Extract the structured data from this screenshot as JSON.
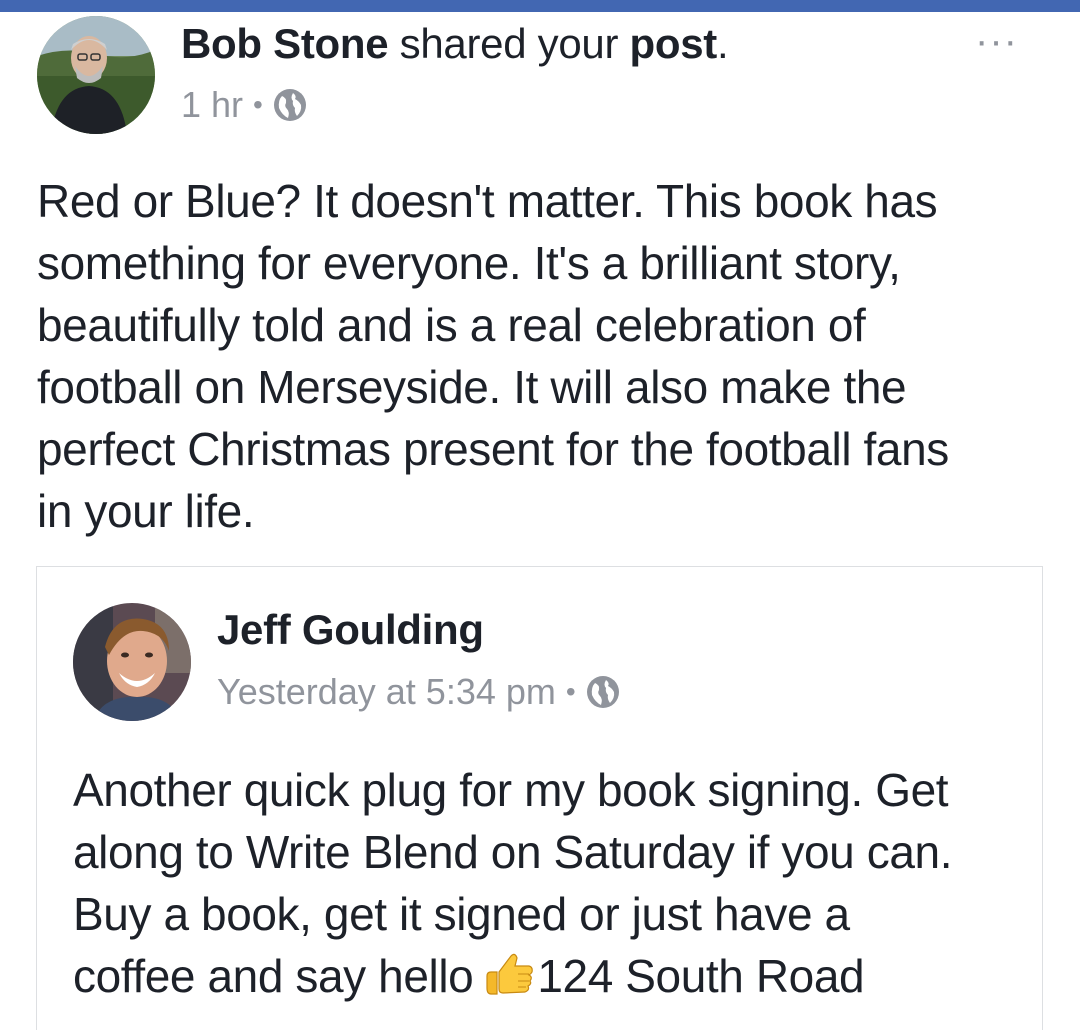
{
  "app": {
    "accent_color": "#4267b2",
    "meta_color": "#90949c",
    "text_color": "#1d2129"
  },
  "post": {
    "author": "Bob Stone",
    "action_text": "shared your",
    "action_object": "post",
    "action_end": ".",
    "timestamp": "1 hr",
    "separator": "•",
    "privacy_icon": "globe-icon",
    "menu_icon": "more-options-icon",
    "menu_label": "···",
    "text_lines": [
      "Red or Blue?  It doesn't matter.  This book has",
      "something for everyone.  It's a brilliant story,",
      "beautifully told and is a real celebration of",
      "football on Merseyside. It will also make the",
      "perfect Christmas present for the football fans",
      "in your life."
    ]
  },
  "shared_post": {
    "author": "Jeff Goulding",
    "timestamp": "Yesterday at 5:34 pm",
    "separator": "•",
    "privacy_icon": "globe-icon",
    "text_lines": [
      "Another quick plug for my book signing. Get",
      "along to Write Blend on Saturday if you can.",
      "Buy a book, get it signed or just have a",
      "coffee and say hello"
    ],
    "emoji_icon": "thumbs-up-emoji-icon",
    "text_after_emoji": "124 South Road"
  }
}
